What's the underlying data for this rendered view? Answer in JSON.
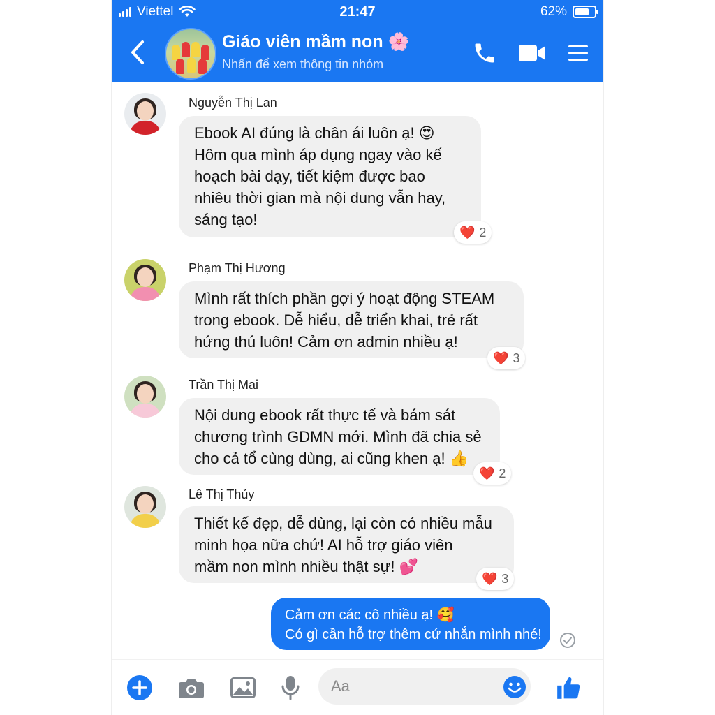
{
  "status_bar": {
    "carrier": "Viettel",
    "time": "21:47",
    "battery": "62%"
  },
  "header": {
    "title": "Giáo viên mầm non 🌸",
    "subtitle": "Nhấn để xem thông tin nhóm",
    "icons": [
      "back-icon",
      "phone-icon",
      "video-icon",
      "menu-icon"
    ]
  },
  "messages": [
    {
      "sender": "Nguyễn Thị Lan",
      "lines": [
        "Ebook AI đúng là chân ái luôn ạ! 😍",
        "Hôm qua mình áp dụng ngay vào kế",
        "hoạch bài dạy, tiết kiệm được bao",
        "nhiêu thời gian mà nội dung vẫn hay,",
        "sáng tạo!"
      ],
      "reaction_emoji": "❤️",
      "reaction_count": "2"
    },
    {
      "sender": "Phạm Thị Hương",
      "lines": [
        "Mình rất thích phần gợi ý hoạt động STEAM",
        "trong ebook. Dễ hiểu, dễ triển khai, trẻ rất",
        "hứng thú luôn! Cảm ơn admin nhiều ạ!"
      ],
      "reaction_emoji": "❤️",
      "reaction_count": "3"
    },
    {
      "sender": "Trần Thị Mai",
      "lines": [
        "Nội dung ebook rất thực tế và bám sát",
        "chương trình GDMN mới. Mình đã chia sẻ",
        "cho cả tổ cùng dùng, ai cũng khen ạ! 👍"
      ],
      "reaction_emoji": "❤️",
      "reaction_count": "2"
    },
    {
      "sender": "Lê Thị Thủy",
      "lines": [
        "Thiết kế đẹp, dễ dùng, lại còn có nhiều mẫu",
        "minh họa nữa chứ! AI hỗ trợ giáo viên",
        "mầm non mình nhiều thật sự! 💕"
      ],
      "reaction_emoji": "❤️",
      "reaction_count": "3"
    }
  ],
  "outgoing": {
    "lines": [
      "Cảm ơn các cô nhiều ạ! 🥰",
      "Có gì cần hỗ trợ thêm cứ nhắn mình nhé!"
    ]
  },
  "composer": {
    "placeholder": "Aa"
  },
  "colors": {
    "brand": "#1a77f2",
    "bubble_in": "#f0f0f0",
    "reaction": "#e0245e"
  }
}
